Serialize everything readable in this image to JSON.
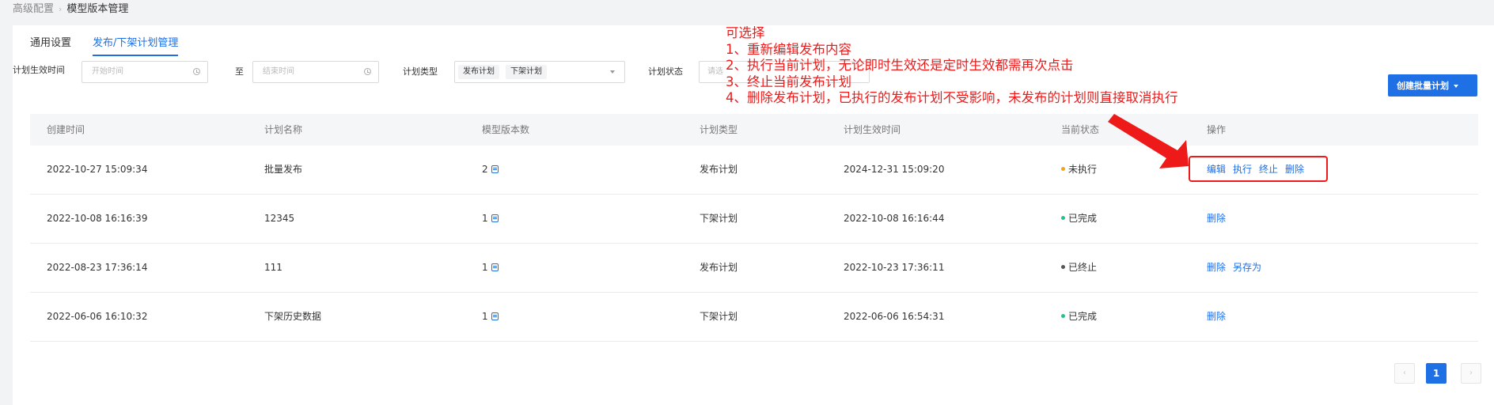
{
  "breadcrumb": {
    "parent": "高级配置",
    "current": "模型版本管理"
  },
  "tabs": [
    {
      "label": "通用设置",
      "active": false
    },
    {
      "label": "发布/下架计划管理",
      "active": true
    }
  ],
  "filters": {
    "effective_time_label": "计划生效时间",
    "start_placeholder": "开始时间",
    "range_separator": "至",
    "end_placeholder": "结束时间",
    "plan_type_label": "计划类型",
    "plan_type_tags": [
      "发布计划",
      "下架计划"
    ],
    "plan_status_label": "计划状态",
    "plan_status_placeholder": "请选"
  },
  "create_button_label": "创建批量计划",
  "table": {
    "columns": [
      "创建时间",
      "计划名称",
      "模型版本数",
      "计划类型",
      "计划生效时间",
      "当前状态",
      "操作"
    ],
    "rows": [
      {
        "created": "2022-10-27 15:09:34",
        "name": "批量发布",
        "version_count": "2",
        "type": "发布计划",
        "effective": "2024-12-31 15:09:20",
        "status": "未执行",
        "status_color": "#f7a21a",
        "actions": [
          "编辑",
          "执行",
          "终止",
          "删除"
        ]
      },
      {
        "created": "2022-10-08 16:16:39",
        "name": "12345",
        "version_count": "1",
        "type": "下架计划",
        "effective": "2022-10-08 16:16:44",
        "status": "已完成",
        "status_color": "#1ec48c",
        "actions": [
          "删除"
        ]
      },
      {
        "created": "2022-08-23 17:36:14",
        "name": "111",
        "version_count": "1",
        "type": "发布计划",
        "effective": "2022-10-23 17:36:11",
        "status": "已终止",
        "status_color": "#555555",
        "actions": [
          "删除",
          "另存为"
        ]
      },
      {
        "created": "2022-06-06 16:10:32",
        "name": "下架历史数据",
        "version_count": "1",
        "type": "下架计划",
        "effective": "2022-06-06 16:54:31",
        "status": "已完成",
        "status_color": "#1ec48c",
        "actions": [
          "删除"
        ]
      }
    ]
  },
  "pagination": {
    "current_page": "1",
    "prev_icon": "chevron-left-icon",
    "next_icon": "chevron-right-icon"
  },
  "annotation": {
    "lines": [
      "可选择",
      "1、重新编辑发布内容",
      "2、执行当前计划，无论即时生效还是定时生效都需再次点击",
      "3、终止当前发布计划",
      "4、删除发布计划，已执行的发布计划不受影响，未发布的计划则直接取消执行"
    ],
    "color": "#ee1a1a"
  },
  "colors": {
    "primary": "#1f6fe5",
    "page_bg": "#f2f3f5",
    "annotation": "#ee1a1a"
  }
}
